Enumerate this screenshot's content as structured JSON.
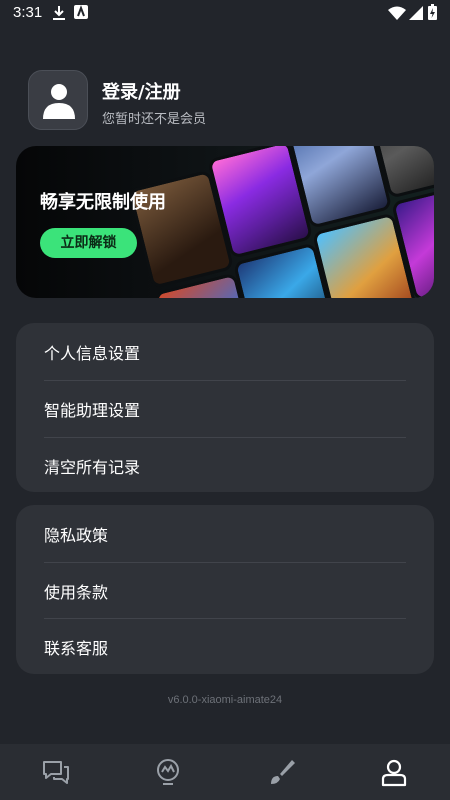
{
  "status": {
    "time": "3:31"
  },
  "profile": {
    "title": "登录/注册",
    "subtitle": "您暂时还不是会员"
  },
  "banner": {
    "title": "畅享无限制使用",
    "button": "立即解锁"
  },
  "settings_menu": [
    {
      "label": "个人信息设置"
    },
    {
      "label": "智能助理设置"
    },
    {
      "label": "清空所有记录"
    }
  ],
  "info_menu": [
    {
      "label": "隐私政策"
    },
    {
      "label": "使用条款"
    },
    {
      "label": "联系客服"
    }
  ],
  "version": "v6.0.0-xiaomi-aimate24",
  "nav": {
    "items": [
      {
        "icon": "chat-icon"
      },
      {
        "icon": "inspiration-icon"
      },
      {
        "icon": "brush-icon"
      },
      {
        "icon": "profile-icon",
        "active": true
      }
    ]
  },
  "colors": {
    "background": "#22252b",
    "card": "#2f3238",
    "accent": "#3be37a"
  }
}
